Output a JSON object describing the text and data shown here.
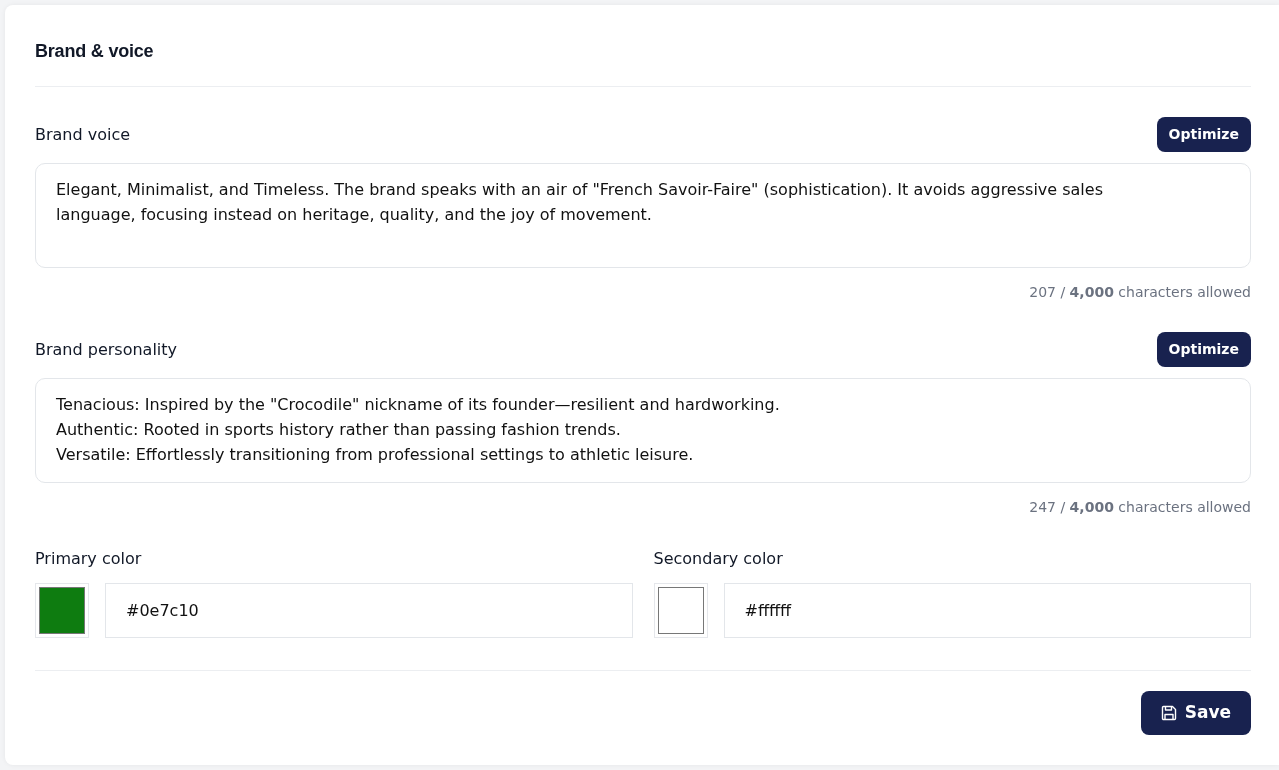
{
  "section": {
    "title": "Brand & voice"
  },
  "text_fields": [
    {
      "label": "Brand voice",
      "button": "Optimize",
      "value": "Elegant, Minimalist, and Timeless. The brand speaks with an air of \"French Savoir-Faire\" (sophistication). It avoids aggressive sales language, focusing instead on heritage, quality, and the joy of movement.",
      "count": "207 / **4,000** characters allowed"
    },
    {
      "label": "Brand personality",
      "button": "Optimize",
      "value": "Tenacious: Inspired by the \"Crocodile\" nickname of its founder—resilient and hardworking.\nAuthentic: Rooted in sports history rather than passing fashion trends.\nVersatile: Effortlessly transitioning from professional settings to athletic leisure.",
      "count": "247 / **4,000** characters allowed"
    }
  ],
  "color_fields": [
    {
      "label": "Primary color",
      "color": "#0e7c10",
      "value": "#0e7c10"
    },
    {
      "label": "Secondary color",
      "color": "#ffffff",
      "value": "#ffffff"
    }
  ],
  "save_button": {
    "label": "Save"
  }
}
